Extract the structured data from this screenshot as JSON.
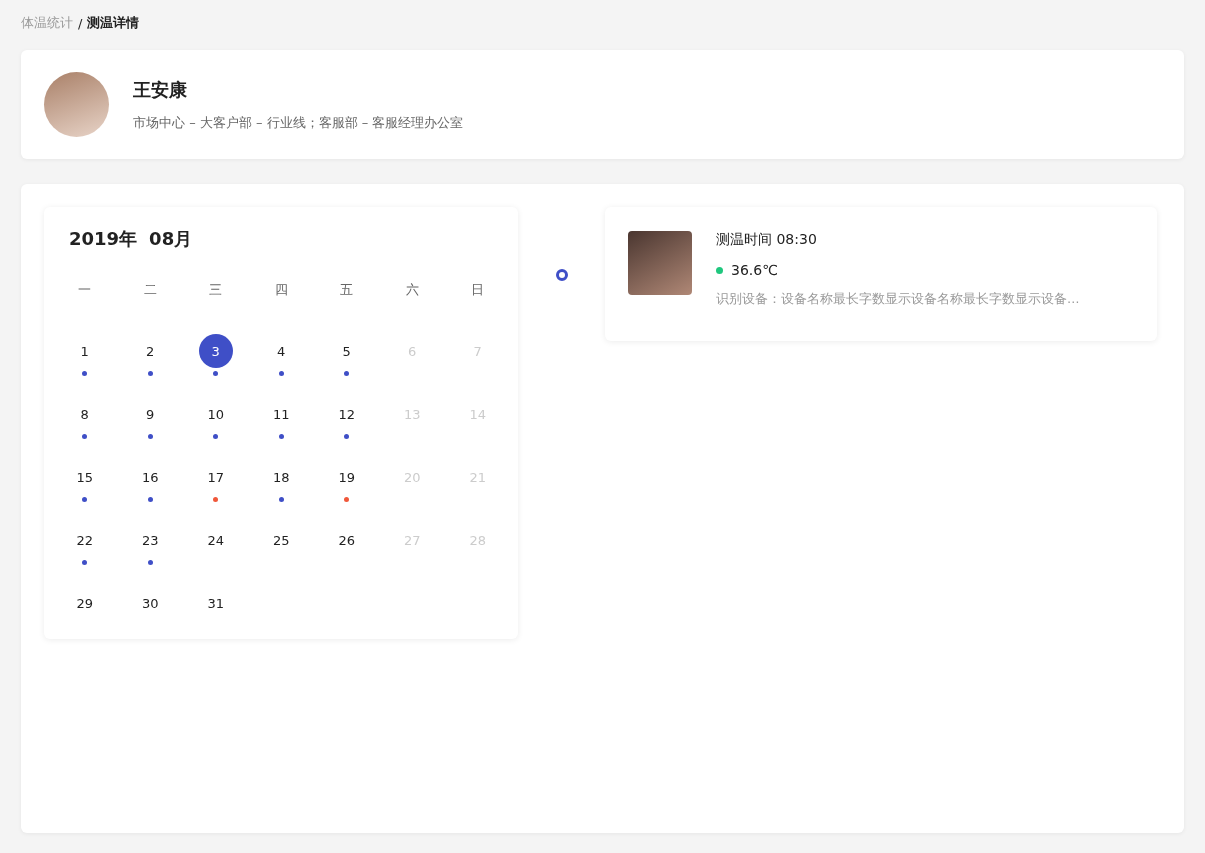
{
  "breadcrumb": [
    {
      "label": "体温统计",
      "current": false
    },
    {
      "label": "测温详情",
      "current": true
    }
  ],
  "breadcrumb_separator": "/",
  "profile": {
    "name": "王安康",
    "department": "市场中心 – 大客户部 – 行业线；客服部 – 客服经理办公室"
  },
  "calendar": {
    "year": "2019年",
    "month": "08月",
    "weekdays": [
      "一",
      "二",
      "三",
      "四",
      "五",
      "六",
      "日"
    ],
    "days": [
      {
        "label": "1",
        "muted": false,
        "selected": false,
        "color": "#3f4fc7"
      },
      {
        "label": "2",
        "muted": false,
        "selected": false,
        "color": "#3f4fc7"
      },
      {
        "label": "3",
        "muted": false,
        "selected": true,
        "color": "#3f4fc7"
      },
      {
        "label": "4",
        "muted": false,
        "selected": false,
        "color": "#3f4fc7"
      },
      {
        "label": "5",
        "muted": false,
        "selected": false,
        "color": "#3f4fc7"
      },
      {
        "label": "6",
        "muted": true,
        "selected": false
      },
      {
        "label": "7",
        "muted": true,
        "selected": false
      },
      {
        "label": "8",
        "muted": false,
        "selected": false,
        "color": "#3f4fc7"
      },
      {
        "label": "9",
        "muted": false,
        "selected": false,
        "color": "#3f4fc7"
      },
      {
        "label": "10",
        "muted": false,
        "selected": false,
        "color": "#3f4fc7"
      },
      {
        "label": "11",
        "muted": false,
        "selected": false,
        "color": "#3f4fc7"
      },
      {
        "label": "12",
        "muted": false,
        "selected": false,
        "color": "#3f4fc7"
      },
      {
        "label": "13",
        "muted": true,
        "selected": false
      },
      {
        "label": "14",
        "muted": true,
        "selected": false
      },
      {
        "label": "15",
        "muted": false,
        "selected": false,
        "color": "#3f4fc7"
      },
      {
        "label": "16",
        "muted": false,
        "selected": false,
        "color": "#3f4fc7"
      },
      {
        "label": "17",
        "muted": false,
        "selected": false,
        "color": "#f0573a"
      },
      {
        "label": "18",
        "muted": false,
        "selected": false,
        "color": "#3f4fc7"
      },
      {
        "label": "19",
        "muted": false,
        "selected": false,
        "color": "#f0573a"
      },
      {
        "label": "20",
        "muted": true,
        "selected": false
      },
      {
        "label": "21",
        "muted": true,
        "selected": false
      },
      {
        "label": "22",
        "muted": false,
        "selected": false,
        "color": "#3f4fc7"
      },
      {
        "label": "23",
        "muted": false,
        "selected": false,
        "color": "#3f4fc7"
      },
      {
        "label": "24",
        "muted": false,
        "selected": false
      },
      {
        "label": "25",
        "muted": false,
        "selected": false
      },
      {
        "label": "26",
        "muted": false,
        "selected": false
      },
      {
        "label": "27",
        "muted": true,
        "selected": false
      },
      {
        "label": "28",
        "muted": true,
        "selected": false
      },
      {
        "label": "29",
        "muted": false,
        "selected": false
      },
      {
        "label": "30",
        "muted": false,
        "selected": false
      },
      {
        "label": "31",
        "muted": false,
        "selected": false
      }
    ]
  },
  "records": [
    {
      "time": "测温时间 08:30",
      "temperature": "36.6℃",
      "color": "#1fc77e",
      "device": "识别设备：设备名称最长字数显示设备名称最长字数显示设备…"
    }
  ]
}
